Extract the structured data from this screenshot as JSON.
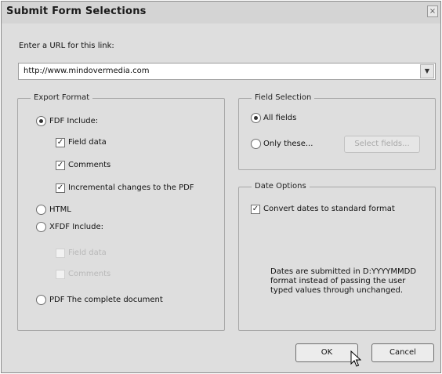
{
  "dialog": {
    "title": "Submit Form Selections",
    "close_glyph": "×"
  },
  "url": {
    "label": "Enter a URL for this link:",
    "value": "http://www.mindovermedia.com",
    "dropdown_glyph": "▼"
  },
  "export_format": {
    "legend": "Export Format",
    "options": {
      "fdf": {
        "label": "FDF  Include:",
        "selected": true,
        "includes": [
          {
            "label": "Field data",
            "checked": true
          },
          {
            "label": "Comments",
            "checked": true
          },
          {
            "label": "Incremental changes to the PDF",
            "checked": true
          }
        ]
      },
      "html": {
        "label": "HTML",
        "selected": false
      },
      "xfdf": {
        "label": "XFDF  Include:",
        "selected": false,
        "includes": [
          {
            "label": "Field data",
            "checked": false,
            "disabled": true
          },
          {
            "label": "Comments",
            "checked": false,
            "disabled": true
          }
        ]
      },
      "pdf": {
        "label": "PDF  The complete document",
        "selected": false
      }
    }
  },
  "field_selection": {
    "legend": "Field Selection",
    "all_fields": "All fields",
    "only_these": "Only these...",
    "select_fields_button": "Select fields..."
  },
  "date_options": {
    "legend": "Date Options",
    "convert_label": "Convert dates to standard format",
    "convert_checked": true,
    "note": "Dates are submitted in D:YYYYMMDD format instead of passing the user typed values through unchanged."
  },
  "buttons": {
    "ok": "OK",
    "cancel": "Cancel"
  },
  "check_glyph": "✓"
}
